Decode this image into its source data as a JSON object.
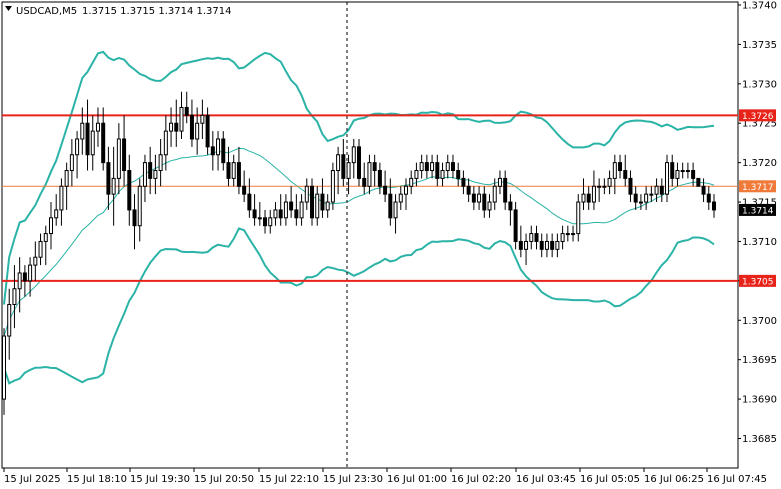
{
  "chart_data": {
    "type": "candlestick",
    "symbol_header": "USDCAD,M5",
    "ohlc_header": "1.3715 1.3715 1.3714 1.3714",
    "y_axis": {
      "min": 1.368,
      "max": 1.374,
      "ticks": [
        "1.3740",
        "1.3735",
        "1.3730",
        "1.3725",
        "1.3720",
        "1.3715",
        "1.3710",
        "1.3705",
        "1.3700",
        "1.3695",
        "1.3690",
        "1.3685"
      ],
      "gridlines": false
    },
    "x_axis": {
      "ticks": [
        "15 Jul 2025",
        "15 Jul 18:10",
        "15 Jul 19:30",
        "15 Jul 20:50",
        "15 Jul 22:10",
        "15 Jul 23:30",
        "16 Jul 01:00",
        "16 Jul 02:20",
        "16 Jul 03:45",
        "16 Jul 05:05",
        "16 Jul 06:25",
        "16 Jul 07:45"
      ]
    },
    "horizontal_levels": [
      {
        "value": 1.3726,
        "label": "1.3726",
        "color": "#e8231a",
        "style": "thick"
      },
      {
        "value": 1.3717,
        "label": "1.3717",
        "color": "#f07a3a",
        "style": "thin"
      },
      {
        "value": 1.3705,
        "label": "1.3705",
        "color": "#e8231a",
        "style": "thick"
      }
    ],
    "current_price": {
      "value": 1.3714,
      "label": "1.3714"
    },
    "session_separator_index": 11.5,
    "bollinger_color": "#2ab3a6",
    "candle_color": "#000000",
    "candles": [
      [
        1.369,
        1.3699,
        1.3688,
        1.3698
      ],
      [
        1.3698,
        1.3704,
        1.3695,
        1.3702
      ],
      [
        1.3702,
        1.3707,
        1.3699,
        1.3704
      ],
      [
        1.3704,
        1.3708,
        1.3701,
        1.3706
      ],
      [
        1.3706,
        1.3707,
        1.3703,
        1.3705
      ],
      [
        1.3705,
        1.3708,
        1.3703,
        1.3707
      ],
      [
        1.3707,
        1.371,
        1.3705,
        1.3708
      ],
      [
        1.3708,
        1.3711,
        1.3707,
        1.371
      ],
      [
        1.371,
        1.3712,
        1.3707,
        1.3711
      ],
      [
        1.3711,
        1.3715,
        1.3709,
        1.3713
      ],
      [
        1.3713,
        1.3716,
        1.3712,
        1.3714
      ],
      [
        1.3714,
        1.3718,
        1.3712,
        1.3717
      ],
      [
        1.3717,
        1.372,
        1.3714,
        1.3719
      ],
      [
        1.3719,
        1.3723,
        1.3717,
        1.3721
      ],
      [
        1.3721,
        1.3724,
        1.3718,
        1.3723
      ],
      [
        1.3723,
        1.3727,
        1.3721,
        1.3725
      ],
      [
        1.3725,
        1.3728,
        1.3719,
        1.3721
      ],
      [
        1.3721,
        1.3726,
        1.3719,
        1.3724
      ],
      [
        1.3724,
        1.3727,
        1.3722,
        1.3725
      ],
      [
        1.3725,
        1.3727,
        1.3719,
        1.372
      ],
      [
        1.372,
        1.3722,
        1.3714,
        1.3716
      ],
      [
        1.3716,
        1.3722,
        1.3712,
        1.3718
      ],
      [
        1.3718,
        1.3725,
        1.3716,
        1.3723
      ],
      [
        1.3723,
        1.3726,
        1.3717,
        1.3719
      ],
      [
        1.3719,
        1.3721,
        1.3712,
        1.3714
      ],
      [
        1.3714,
        1.3716,
        1.3709,
        1.3712
      ],
      [
        1.3712,
        1.3718,
        1.371,
        1.3717
      ],
      [
        1.3717,
        1.3721,
        1.3715,
        1.372
      ],
      [
        1.372,
        1.3722,
        1.3716,
        1.3718
      ],
      [
        1.3718,
        1.3721,
        1.3716,
        1.3719
      ],
      [
        1.3719,
        1.3723,
        1.3717,
        1.3721
      ],
      [
        1.3721,
        1.3726,
        1.3719,
        1.3724
      ],
      [
        1.3724,
        1.3727,
        1.3722,
        1.3725
      ],
      [
        1.3725,
        1.3728,
        1.3722,
        1.3724
      ],
      [
        1.3724,
        1.3729,
        1.3723,
        1.3727
      ],
      [
        1.3727,
        1.3729,
        1.3725,
        1.3726
      ],
      [
        1.3726,
        1.3728,
        1.3722,
        1.3723
      ],
      [
        1.3723,
        1.3727,
        1.3721,
        1.3725
      ],
      [
        1.3725,
        1.3728,
        1.3723,
        1.3726
      ],
      [
        1.3726,
        1.3727,
        1.3721,
        1.3722
      ],
      [
        1.3722,
        1.3724,
        1.3719,
        1.3721
      ],
      [
        1.3721,
        1.3724,
        1.3719,
        1.3723
      ],
      [
        1.3723,
        1.3724,
        1.3719,
        1.372
      ],
      [
        1.372,
        1.3722,
        1.3717,
        1.3718
      ],
      [
        1.3718,
        1.3721,
        1.3717,
        1.372
      ],
      [
        1.372,
        1.3722,
        1.3716,
        1.3717
      ],
      [
        1.3717,
        1.3719,
        1.3715,
        1.3716
      ],
      [
        1.3716,
        1.3718,
        1.3713,
        1.3714
      ],
      [
        1.3714,
        1.3716,
        1.3712,
        1.3713
      ],
      [
        1.3713,
        1.3715,
        1.3712,
        1.3713
      ],
      [
        1.3713,
        1.3714,
        1.3711,
        1.3712
      ],
      [
        1.3712,
        1.3714,
        1.3711,
        1.3713
      ],
      [
        1.3713,
        1.3715,
        1.3712,
        1.3714
      ],
      [
        1.3714,
        1.3716,
        1.3712,
        1.3713
      ],
      [
        1.3713,
        1.3716,
        1.3712,
        1.3715
      ],
      [
        1.3715,
        1.3717,
        1.3713,
        1.3714
      ],
      [
        1.3714,
        1.3716,
        1.3712,
        1.3713
      ],
      [
        1.3713,
        1.3716,
        1.3712,
        1.3715
      ],
      [
        1.3715,
        1.3718,
        1.3714,
        1.3717
      ],
      [
        1.3717,
        1.3718,
        1.3712,
        1.3713
      ],
      [
        1.3713,
        1.3717,
        1.3712,
        1.3716
      ],
      [
        1.3716,
        1.3718,
        1.3713,
        1.3714
      ],
      [
        1.3714,
        1.3716,
        1.3713,
        1.3715
      ],
      [
        1.3715,
        1.372,
        1.3714,
        1.3719
      ],
      [
        1.3719,
        1.3722,
        1.3716,
        1.3721
      ],
      [
        1.3721,
        1.3723,
        1.3717,
        1.3718
      ],
      [
        1.3718,
        1.3721,
        1.3716,
        1.372
      ],
      [
        1.372,
        1.3723,
        1.3718,
        1.3722
      ],
      [
        1.3722,
        1.3723,
        1.3717,
        1.3718
      ],
      [
        1.3718,
        1.372,
        1.3716,
        1.3717
      ],
      [
        1.3717,
        1.3721,
        1.3716,
        1.372
      ],
      [
        1.372,
        1.3721,
        1.3717,
        1.3719
      ],
      [
        1.3719,
        1.372,
        1.3716,
        1.3717
      ],
      [
        1.3717,
        1.3719,
        1.3715,
        1.3716
      ],
      [
        1.3716,
        1.3718,
        1.3712,
        1.3713
      ],
      [
        1.3713,
        1.3716,
        1.3711,
        1.3715
      ],
      [
        1.3715,
        1.3717,
        1.3714,
        1.3716
      ],
      [
        1.3716,
        1.3718,
        1.3714,
        1.3717
      ],
      [
        1.3717,
        1.3719,
        1.3716,
        1.3718
      ],
      [
        1.3718,
        1.372,
        1.3717,
        1.3719
      ],
      [
        1.3719,
        1.3721,
        1.3718,
        1.372
      ],
      [
        1.372,
        1.3721,
        1.3718,
        1.3719
      ],
      [
        1.3719,
        1.3721,
        1.3718,
        1.372
      ],
      [
        1.372,
        1.3721,
        1.3717,
        1.3718
      ],
      [
        1.3718,
        1.372,
        1.3717,
        1.3719
      ],
      [
        1.3719,
        1.3721,
        1.3718,
        1.372
      ],
      [
        1.372,
        1.3721,
        1.3718,
        1.3719
      ],
      [
        1.3719,
        1.372,
        1.3717,
        1.3718
      ],
      [
        1.3718,
        1.3719,
        1.3716,
        1.3717
      ],
      [
        1.3717,
        1.3718,
        1.3715,
        1.3716
      ],
      [
        1.3716,
        1.3717,
        1.3714,
        1.3715
      ],
      [
        1.3715,
        1.3717,
        1.3714,
        1.3716
      ],
      [
        1.3716,
        1.3717,
        1.3713,
        1.3714
      ],
      [
        1.3714,
        1.3716,
        1.3713,
        1.3715
      ],
      [
        1.3715,
        1.3718,
        1.3714,
        1.3717
      ],
      [
        1.3717,
        1.3719,
        1.3716,
        1.3718
      ],
      [
        1.3718,
        1.3719,
        1.3714,
        1.3715
      ],
      [
        1.3715,
        1.3716,
        1.3712,
        1.3714
      ],
      [
        1.3714,
        1.3715,
        1.3709,
        1.371
      ],
      [
        1.371,
        1.3712,
        1.3708,
        1.3709
      ],
      [
        1.3709,
        1.3711,
        1.3707,
        1.371
      ],
      [
        1.371,
        1.3712,
        1.3709,
        1.3711
      ],
      [
        1.3711,
        1.3712,
        1.3709,
        1.371
      ],
      [
        1.371,
        1.3711,
        1.3708,
        1.3709
      ],
      [
        1.3709,
        1.3711,
        1.3708,
        1.371
      ],
      [
        1.371,
        1.3711,
        1.3708,
        1.3709
      ],
      [
        1.3709,
        1.3711,
        1.3708,
        1.371
      ],
      [
        1.371,
        1.3712,
        1.3709,
        1.3711
      ],
      [
        1.3711,
        1.3712,
        1.371,
        1.3711
      ],
      [
        1.3711,
        1.3712,
        1.371,
        1.3711
      ],
      [
        1.3711,
        1.3716,
        1.371,
        1.3715
      ],
      [
        1.3715,
        1.3718,
        1.3714,
        1.3716
      ],
      [
        1.3716,
        1.3717,
        1.3714,
        1.3715
      ],
      [
        1.3715,
        1.3719,
        1.3714,
        1.3717
      ],
      [
        1.3717,
        1.3718,
        1.3715,
        1.3717
      ],
      [
        1.3717,
        1.3718,
        1.3716,
        1.3717
      ],
      [
        1.3717,
        1.3719,
        1.3716,
        1.3718
      ],
      [
        1.3718,
        1.3721,
        1.3716,
        1.372
      ],
      [
        1.372,
        1.3721,
        1.3718,
        1.3719
      ],
      [
        1.3719,
        1.3721,
        1.3717,
        1.3718
      ],
      [
        1.3718,
        1.3719,
        1.3715,
        1.3716
      ],
      [
        1.3716,
        1.3717,
        1.3714,
        1.3715
      ],
      [
        1.3715,
        1.3716,
        1.3714,
        1.3715
      ],
      [
        1.3715,
        1.3717,
        1.3714,
        1.3716
      ],
      [
        1.3716,
        1.3717,
        1.3715,
        1.3716
      ],
      [
        1.3716,
        1.3718,
        1.3715,
        1.3717
      ],
      [
        1.3717,
        1.3718,
        1.3715,
        1.3716
      ],
      [
        1.3716,
        1.3721,
        1.3715,
        1.372
      ],
      [
        1.372,
        1.3721,
        1.3717,
        1.3718
      ],
      [
        1.3718,
        1.372,
        1.3717,
        1.3719
      ],
      [
        1.3719,
        1.372,
        1.3718,
        1.3719
      ],
      [
        1.3719,
        1.372,
        1.3718,
        1.3719
      ],
      [
        1.3719,
        1.372,
        1.3717,
        1.3718
      ],
      [
        1.3718,
        1.3718,
        1.3717,
        1.3717
      ],
      [
        1.3717,
        1.3718,
        1.3715,
        1.3716
      ],
      [
        1.3716,
        1.3717,
        1.3714,
        1.3715
      ],
      [
        1.3715,
        1.3716,
        1.3713,
        1.3714
      ]
    ]
  }
}
